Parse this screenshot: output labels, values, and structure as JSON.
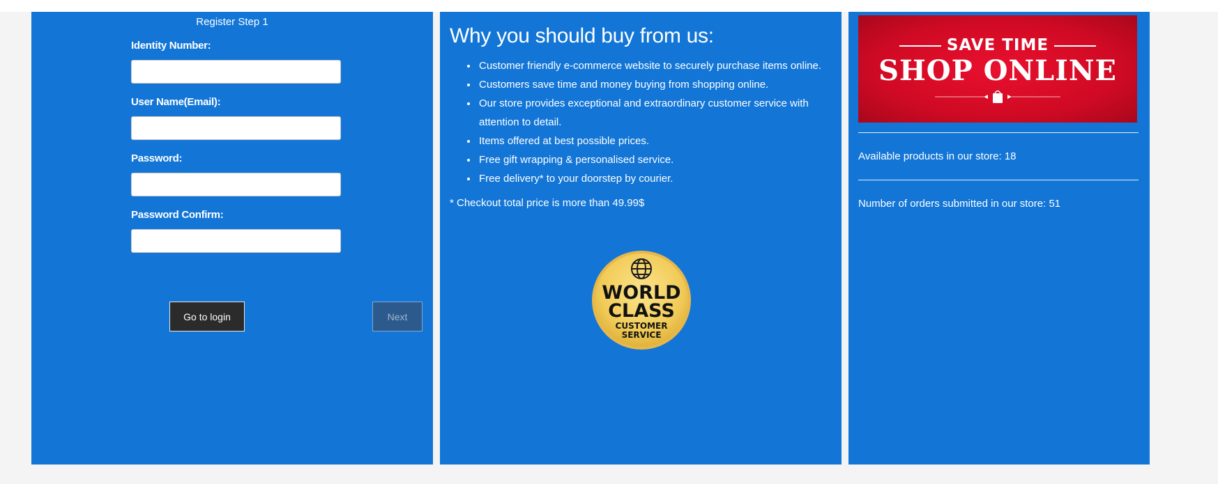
{
  "register": {
    "title": "Register Step 1",
    "fields": [
      {
        "label": "Identity Number:",
        "value": "",
        "placeholder": ""
      },
      {
        "label": "User Name(Email):",
        "value": "",
        "placeholder": ""
      },
      {
        "label": "Password:",
        "value": "",
        "placeholder": ""
      },
      {
        "label": "Password Confirm:",
        "value": "",
        "placeholder": ""
      }
    ],
    "login_button": "Go to login",
    "next_button": "Next"
  },
  "why": {
    "title": "Why you should buy from us:",
    "items": [
      "Customer friendly e-commerce website to securely purchase items online.",
      "Customers save time and money buying from shopping online.",
      "Our store provides exceptional and extraordinary customer service with attention to detail.",
      "Items offered at best possible prices.",
      "Free gift wrapping & personalised service.",
      "Free delivery* to your doorstep by courier."
    ],
    "footnote": "* Checkout total price is more than 49.99$",
    "badge": {
      "line1": "WORLD",
      "line2": "CLASS",
      "line3": "CUSTOMER",
      "line4": "SERVICE",
      "icon": "globe-icon"
    }
  },
  "stats": {
    "promo": {
      "line1": "SAVE TIME",
      "line2": "SHOP ONLINE"
    },
    "products": "Available products in our store: 18",
    "orders": "Number of orders submitted in our store: 51"
  },
  "colors": {
    "panel": "#1376d7",
    "page_bg": "#f4f4f4",
    "promo_red": "#d10a24",
    "badge_gold": "#f2cc5a"
  }
}
